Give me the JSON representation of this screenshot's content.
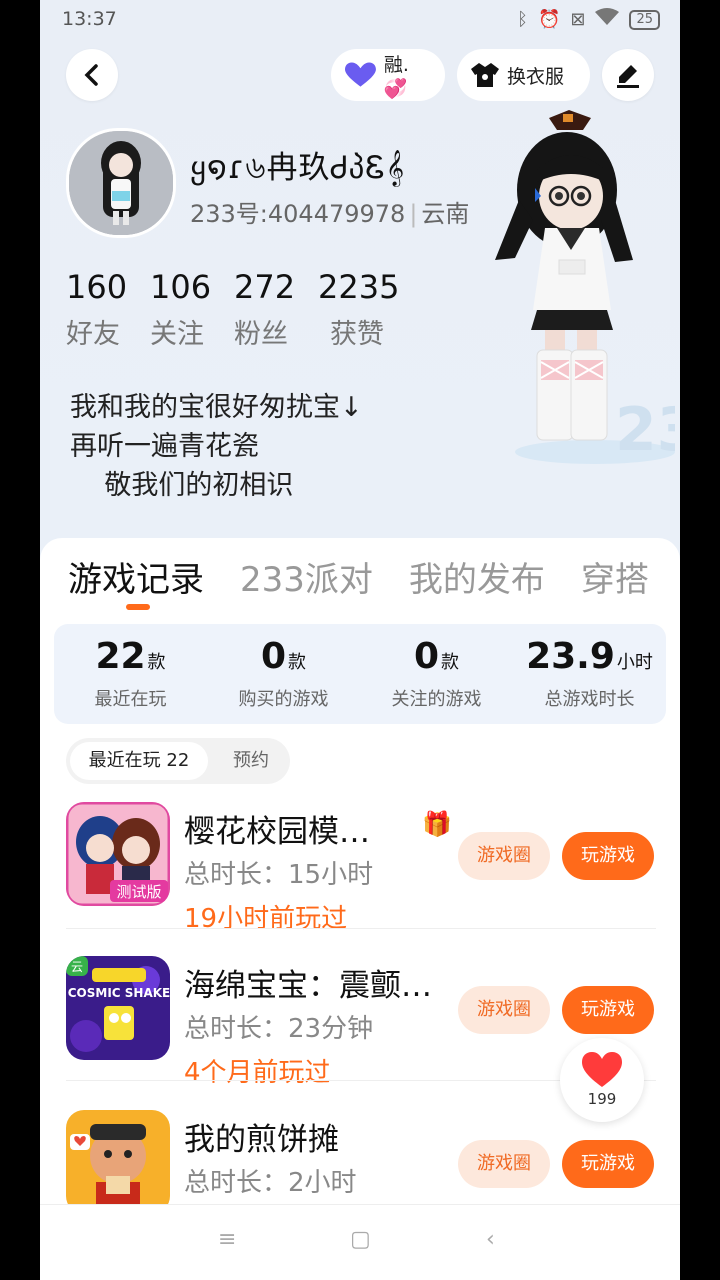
{
  "status_bar": {
    "time": "13:37",
    "battery": "25"
  },
  "header": {
    "badge_label": "融.💞",
    "wardrobe_label": "换衣服"
  },
  "profile": {
    "name": "ყ໑ɾ৬冉玖ᏧპᏋ𝄞",
    "uid": "233号:404479978",
    "region": "云南",
    "stats": [
      {
        "value": "160",
        "label": "好友"
      },
      {
        "value": "106",
        "label": "关注"
      },
      {
        "value": "272",
        "label": "粉丝"
      },
      {
        "value": "2235",
        "label": "获赞"
      }
    ],
    "bio": "我和我的宝很好匆扰宝↓\n再听一遍青花瓷\n    敬我们的初相识"
  },
  "tabs": [
    "游戏记录",
    "233派对",
    "我的发布",
    "穿搭"
  ],
  "summary": [
    {
      "value": "22",
      "unit": "款",
      "label": "最近在玩"
    },
    {
      "value": "0",
      "unit": "款",
      "label": "购买的游戏"
    },
    {
      "value": "0",
      "unit": "款",
      "label": "关注的游戏"
    },
    {
      "value": "23.9",
      "unit": "小时",
      "label": "总游戏时长"
    }
  ],
  "segment": {
    "active": "最近在玩 22",
    "inactive": "预约"
  },
  "games": [
    {
      "title": "樱花校园模…",
      "duration": "总时长：15小时",
      "last_played": "19小时前玩过",
      "circle_label": "游戏圈",
      "play_label": "玩游戏",
      "icon_text": "测试版"
    },
    {
      "title": "海绵宝宝：震颤…",
      "duration": "总时长：23分钟",
      "last_played": "4个月前玩过",
      "circle_label": "游戏圈",
      "play_label": "玩游戏",
      "icon_text": "COSMIC SHAKE",
      "cloud_tag": "云"
    },
    {
      "title": "我的煎饼摊",
      "duration": "总时长：2小时",
      "last_played": "",
      "circle_label": "游戏圈",
      "play_label": "玩游戏"
    }
  ],
  "favorite": {
    "count": "199"
  },
  "colors": {
    "accent": "#ff6a1a",
    "circle_btn_bg": "#fde8dc"
  }
}
